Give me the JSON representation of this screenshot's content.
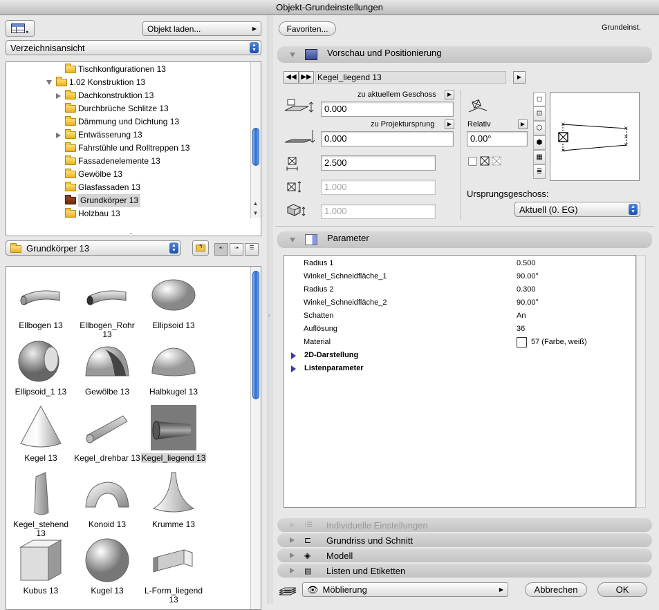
{
  "window": {
    "title": "Objekt-Grundeinstellungen"
  },
  "left": {
    "objekt_laden": "Objekt laden...",
    "view_mode": "Verzeichnisansicht",
    "tree": [
      {
        "label": "Tischkonfigurationen 13",
        "level": 2,
        "toggle": "",
        "folder": "yellow"
      },
      {
        "label": "1.02 Konstruktion 13",
        "level": 1,
        "toggle": "open",
        "folder": "yellow"
      },
      {
        "label": "Dachkonstruktion 13",
        "level": 2,
        "toggle": "closed",
        "folder": "yellow"
      },
      {
        "label": "Durchbrüche Schlitze 13",
        "level": 2,
        "toggle": "",
        "folder": "yellow"
      },
      {
        "label": "Dämmung und Dichtung 13",
        "level": 2,
        "toggle": "",
        "folder": "yellow"
      },
      {
        "label": "Entwässerung 13",
        "level": 2,
        "toggle": "closed",
        "folder": "yellow"
      },
      {
        "label": "Fahrstühle und Rolltreppen 13",
        "level": 2,
        "toggle": "",
        "folder": "yellow"
      },
      {
        "label": "Fassadenelemente 13",
        "level": 2,
        "toggle": "",
        "folder": "yellow"
      },
      {
        "label": "Gewölbe 13",
        "level": 2,
        "toggle": "",
        "folder": "yellow"
      },
      {
        "label": "Glasfassaden 13",
        "level": 2,
        "toggle": "",
        "folder": "yellow"
      },
      {
        "label": "Grundkörper 13",
        "level": 2,
        "toggle": "",
        "folder": "red",
        "selected": true
      },
      {
        "label": "Holzbau 13",
        "level": 2,
        "toggle": "",
        "folder": "yellow"
      }
    ],
    "folder_select": "Grundkörper 13",
    "objects": [
      {
        "label": "Ellbogen 13",
        "shape": "ellbogen"
      },
      {
        "label": "Ellbogen_Rohr 13",
        "shape": "ellbogen_rohr"
      },
      {
        "label": "Ellipsoid 13",
        "shape": "ellipsoid"
      },
      {
        "label": "Ellipsoid_1 13",
        "shape": "ellipsoid1"
      },
      {
        "label": "Gewölbe 13",
        "shape": "gewoelbe"
      },
      {
        "label": "Halbkugel 13",
        "shape": "halbkugel"
      },
      {
        "label": "Kegel 13",
        "shape": "kegel"
      },
      {
        "label": "Kegel_drehbar 13",
        "shape": "kegel_drehbar"
      },
      {
        "label": "Kegel_liegend 13",
        "shape": "kegel_liegend",
        "selected": true
      },
      {
        "label": "Kegel_stehend 13",
        "shape": "kegel_stehend"
      },
      {
        "label": "Konoid 13",
        "shape": "konoid"
      },
      {
        "label": "Krumme 13",
        "shape": "krumme"
      },
      {
        "label": "Kubus 13",
        "shape": "kubus"
      },
      {
        "label": "Kugel 13",
        "shape": "kugel"
      },
      {
        "label": "L-Form_liegend 13",
        "shape": "lform"
      }
    ]
  },
  "right": {
    "favoriten": "Favoriten...",
    "grundeinst": "Grundeinst.",
    "sections": {
      "vorschau": "Vorschau und Positionierung",
      "parameter": "Parameter",
      "individuelle": "Individuelle Einstellungen",
      "grundriss": "Grundriss und Schnitt",
      "modell": "Modell",
      "listen": "Listen und Etiketten"
    },
    "object_name": "Kegel_liegend 13",
    "positioning": {
      "geschoss_label": "zu aktuellem Geschoss",
      "geschoss_value": "0.000",
      "projekt_label": "zu Projektursprung",
      "projekt_value": "0.000",
      "width": "2.500",
      "length": "1.000",
      "height": "1.000",
      "relativ_label": "Relativ",
      "angle": "0.00°",
      "ursprung_label": "Ursprungsgeschoss:",
      "ursprung_value": "Aktuell (0. EG)"
    },
    "params": [
      {
        "name": "Radius 1",
        "value": "0.500"
      },
      {
        "name": "Winkel_Schneidfläche_1",
        "value": "90.00°"
      },
      {
        "name": "Radius 2",
        "value": "0.300"
      },
      {
        "name": "Winkel_Schneidfläche_2",
        "value": "90.00°"
      },
      {
        "name": "Schatten",
        "value": "An"
      },
      {
        "name": "Auflösung",
        "value": "36"
      },
      {
        "name": "Material",
        "value": "57 (Farbe, weiß)"
      }
    ],
    "param_groups": [
      "2D-Darstellung",
      "Listenparameter"
    ],
    "layer": "Möblierung",
    "cancel": "Abbrechen",
    "ok": "OK"
  }
}
